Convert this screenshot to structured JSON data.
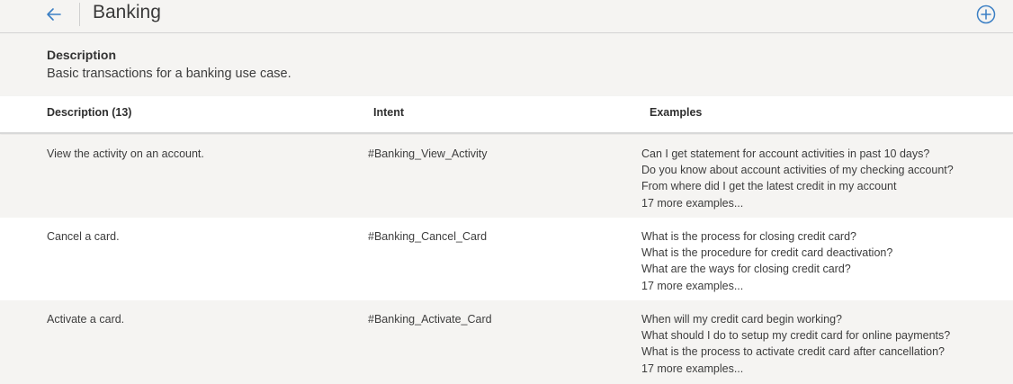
{
  "header": {
    "title": "Banking",
    "back_icon": "arrow-left-icon",
    "add_icon": "plus-circle-icon",
    "accent_color": "#3b7fc4"
  },
  "description": {
    "label": "Description",
    "text": "Basic transactions for a banking use case."
  },
  "table": {
    "columns": {
      "description": "Description (13)",
      "intent": "Intent",
      "examples": "Examples"
    },
    "rows": [
      {
        "description": "View the activity on an account.",
        "intent": "#Banking_View_Activity",
        "examples": [
          "Can I get statement for account activities in past 10 days?",
          "Do you know about account activities of my checking account?",
          "From where did I get the latest credit in my account"
        ],
        "more": "17 more examples..."
      },
      {
        "description": "Cancel a card.",
        "intent": "#Banking_Cancel_Card",
        "examples": [
          "What is the process for closing credit card?",
          "What is the procedure for credit card deactivation?",
          "What are the ways for closing credit card?"
        ],
        "more": "17 more examples..."
      },
      {
        "description": "Activate a card.",
        "intent": "#Banking_Activate_Card",
        "examples": [
          "When will my credit card begin working?",
          "What should I do to setup my credit card for online payments?",
          "What is the process to activate credit card after cancellation?"
        ],
        "more": "17 more examples..."
      }
    ]
  }
}
